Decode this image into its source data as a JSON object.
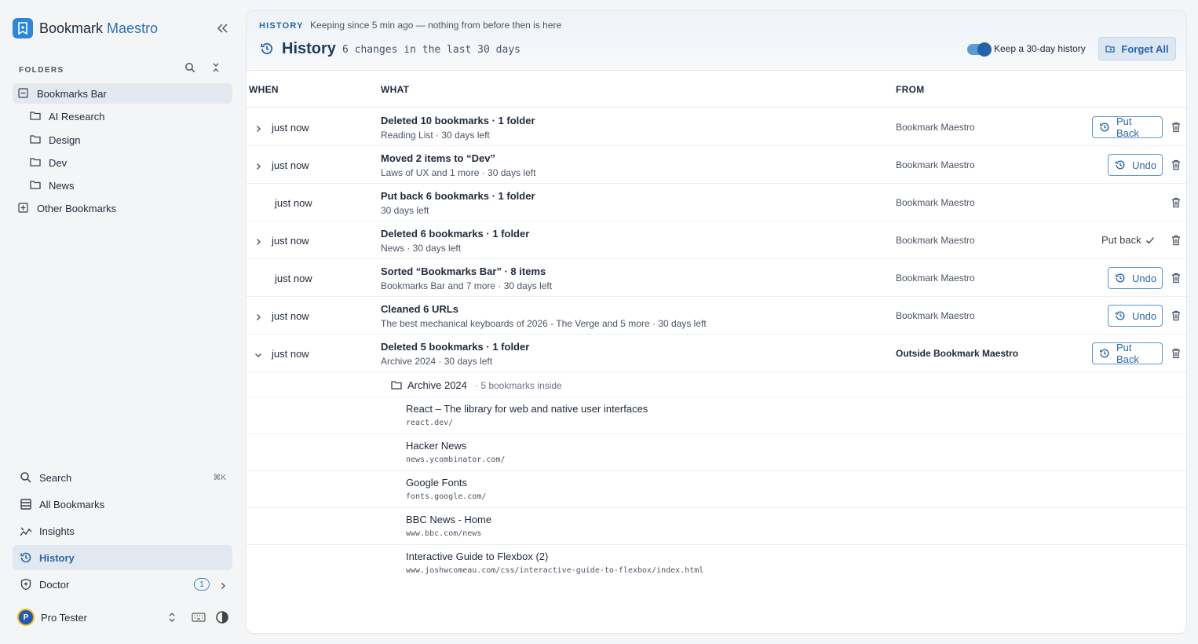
{
  "app": {
    "name_part1": "Bookmark",
    "name_part2": "Maestro"
  },
  "folders": {
    "label": "FOLDERS",
    "tree": [
      {
        "label": "Bookmarks Bar",
        "level": 0,
        "kind": "minus-square",
        "selected": true
      },
      {
        "label": "AI Research",
        "level": 1,
        "kind": "folder"
      },
      {
        "label": "Design",
        "level": 1,
        "kind": "folder"
      },
      {
        "label": "Dev",
        "level": 1,
        "kind": "folder"
      },
      {
        "label": "News",
        "level": 1,
        "kind": "folder"
      },
      {
        "label": "Other Bookmarks",
        "level": 0,
        "kind": "plus-square"
      }
    ]
  },
  "nav": {
    "search": {
      "label": "Search",
      "shortcut": "⌘K"
    },
    "all": {
      "label": "All Bookmarks"
    },
    "insights": {
      "label": "Insights"
    },
    "history": {
      "label": "History"
    },
    "doctor": {
      "label": "Doctor",
      "badge": "1"
    }
  },
  "user": {
    "initial": "P",
    "name": "Pro Tester"
  },
  "header": {
    "eyebrow": "HISTORY",
    "eyebrow_note": "Keeping since 5 min ago — nothing from before then is here",
    "title": "History",
    "subtitle": "6 changes in the last 30 days",
    "toggle_label": "Keep a 30-day history",
    "toggle_on": true,
    "forget_label": "Forget All"
  },
  "table": {
    "col_when": "WHEN",
    "col_what": "WHAT",
    "col_from": "FROM",
    "rows": [
      {
        "when": "just now",
        "chevron": "right",
        "title": "Deleted 10 bookmarks · 1 folder",
        "sub": "Reading List · 30 days left",
        "from": "Bookmark Maestro",
        "action": "Put Back"
      },
      {
        "when": "just now",
        "chevron": "right",
        "title": "Moved 2 items to “Dev”",
        "sub": "Laws of UX and 1 more · 30 days left",
        "from": "Bookmark Maestro",
        "action": "Undo"
      },
      {
        "when": "just now",
        "chevron": "",
        "title": "Put back 6 bookmarks · 1 folder",
        "sub": "30 days left",
        "from": "Bookmark Maestro",
        "action": ""
      },
      {
        "when": "just now",
        "chevron": "right",
        "title": "Deleted 6 bookmarks · 1 folder",
        "sub": "News · 30 days left",
        "from": "Bookmark Maestro",
        "action": "",
        "done": "Put back"
      },
      {
        "when": "just now",
        "chevron": "",
        "title": "Sorted “Bookmarks Bar” · 8 items",
        "sub": "Bookmarks Bar and 7 more · 30 days left",
        "from": "Bookmark Maestro",
        "action": "Undo"
      },
      {
        "when": "just now",
        "chevron": "right",
        "title": "Cleaned 6 URLs",
        "sub": "The best mechanical keyboards of 2026 - The Verge and 5 more · 30 days left",
        "from": "Bookmark Maestro",
        "action": "Undo"
      },
      {
        "when": "just now",
        "chevron": "down",
        "title": "Deleted 5 bookmarks · 1 folder",
        "sub": "Archive 2024 · 30 days left",
        "from": "Outside Bookmark Maestro",
        "from_bold": true,
        "action": "Put Back"
      }
    ],
    "expanded": {
      "folder_name": "Archive 2024",
      "folder_count": "· 5 bookmarks inside",
      "bookmarks": [
        {
          "title": "React – The library for web and native user interfaces",
          "url": "react.dev/"
        },
        {
          "title": "Hacker News",
          "url": "news.ycombinator.com/"
        },
        {
          "title": "Google Fonts",
          "url": "fonts.google.com/"
        },
        {
          "title": "BBC News - Home",
          "url": "www.bbc.com/news"
        },
        {
          "title": "Interactive Guide to Flexbox (2)",
          "url": "www.joshwcomeau.com/css/interactive-guide-to-flexbox/index.html"
        }
      ]
    }
  },
  "colors": {
    "accent": "#2a66a8",
    "brand": "#2f86d6"
  }
}
